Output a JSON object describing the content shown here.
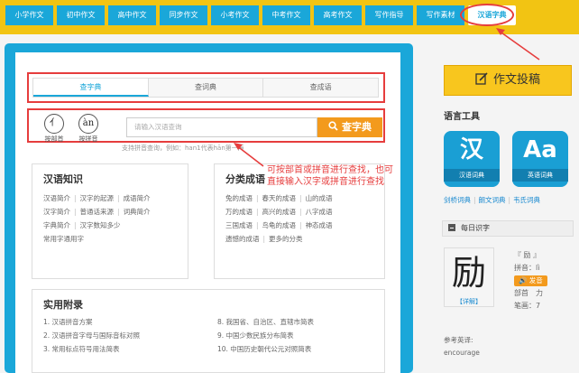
{
  "nav": {
    "tabs": [
      "小学作文",
      "初中作文",
      "高中作文",
      "同步作文",
      "小考作文",
      "中考作文",
      "高考作文",
      "写作指导",
      "写作素材",
      "汉语字典"
    ],
    "active_index": 9,
    "accent": "#1aa7d9",
    "bar_color": "#f2c413"
  },
  "search": {
    "tabs": [
      "查字典",
      "查词典",
      "查成语"
    ],
    "active_index": 0,
    "modes": [
      {
        "glyph": "亻",
        "label": "按部首"
      },
      {
        "glyph": "àn",
        "label": "按拼音"
      }
    ],
    "placeholder": "请输入汉语查询",
    "button_label": "查字典",
    "hint": "支持拼音查询，例如：han1代表hān第一声"
  },
  "knowledge": {
    "title": "汉语知识",
    "rows": [
      [
        "汉语简介",
        "汉字的起源",
        "成语简介"
      ],
      [
        "汉字简介",
        "普通话来源",
        "词典简介"
      ],
      [
        "字典简介",
        "汉字数知多少"
      ],
      [
        "常用字通用字"
      ]
    ]
  },
  "idioms": {
    "title": "分类成语",
    "rows": [
      [
        "兔的成语",
        "春天的成语",
        "山的成语"
      ],
      [
        "万的成语",
        "高兴的成语",
        "八字成语"
      ],
      [
        "三国成语",
        "鸟龟的成语",
        "神态成语"
      ],
      [
        "遗憾的成语",
        "更多的分类"
      ]
    ]
  },
  "appendix": {
    "title": "实用附录",
    "left": [
      "1. 汉语拼音方案",
      "2. 汉语拼音字母与国际音标对照",
      "3. 常用标点符号用法简表"
    ],
    "right": [
      "8. 我国省、自治区、直辖市简表",
      "9. 中国少数民族分布简表",
      "10. 中国历史朝代公元对照简表"
    ]
  },
  "annotation": {
    "line1": "可按部首或拼音进行查找，也可",
    "line2": "直接输入汉字或拼音进行查找",
    "color": "#e63d3d"
  },
  "sidebar": {
    "compose_label": "作文投稿",
    "tools_title": "语言工具",
    "dicts": [
      {
        "glyph": "汉",
        "caption": "汉语词典"
      },
      {
        "glyph": "Aa",
        "caption": "英语词典"
      }
    ],
    "dict_links": [
      "剑桥词典",
      "朗文词典",
      "韦氏词典"
    ],
    "daily_title": "每日识字",
    "char": "励",
    "detail_label": "【详解】",
    "char_name": "『 励 』",
    "pinyin_label": "拼音：",
    "pinyin": "lì",
    "voice_label": "发音",
    "radical": "部首　力",
    "strokes": "笔画：7",
    "ref_label": "参考英译:",
    "ref_value": "encourage"
  }
}
